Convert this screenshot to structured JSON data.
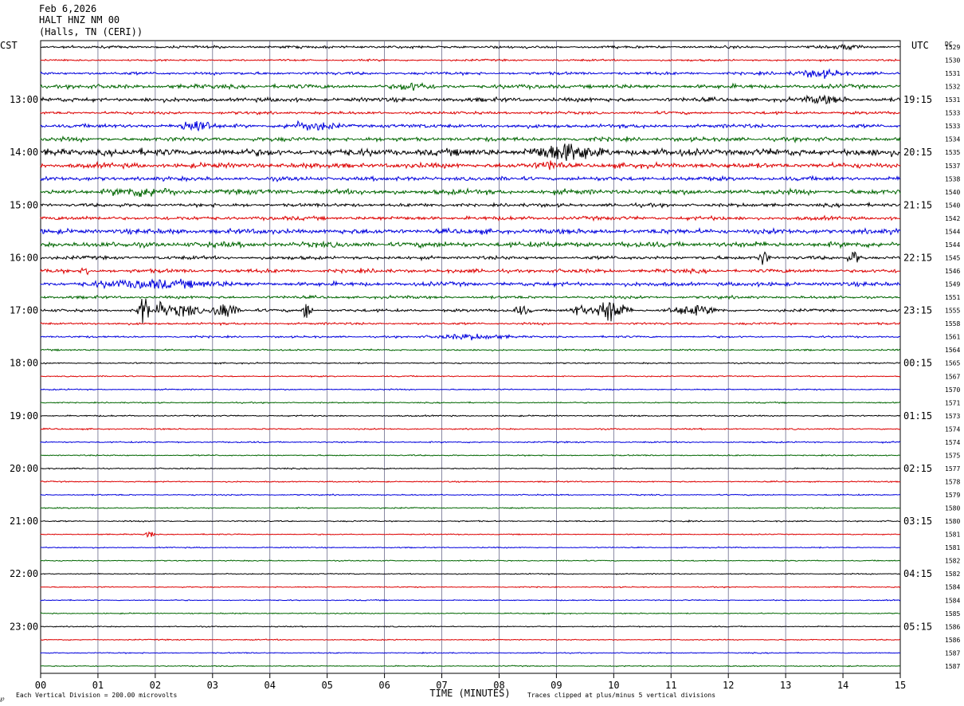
{
  "header": {
    "date": "Feb 6,2026",
    "station": "HALT HNZ NM 00",
    "location": "(Halls, TN (CERI))"
  },
  "footer": {
    "scale_note": "Each Vertical Division =  200.00 microvolts",
    "clip_note": "Traces clipped at plus/minus 5 vertical divisions",
    "corner_mark": "℘"
  },
  "chart_data": {
    "type": "line",
    "title": "",
    "xlabel": "TIME (MINUTES)",
    "left_axis_label": "CST",
    "right_axis_label": "UTC",
    "dc_label": "DC",
    "xlim": [
      0,
      15
    ],
    "x_ticks": [
      "00",
      "01",
      "02",
      "03",
      "04",
      "05",
      "06",
      "07",
      "08",
      "09",
      "10",
      "11",
      "12",
      "13",
      "14",
      "15"
    ],
    "grid": true,
    "trace_colors": [
      "#000000",
      "#dd0000",
      "#0000dd",
      "#006600"
    ],
    "left_hours": [
      {
        "row": 4,
        "label": "13:00"
      },
      {
        "row": 8,
        "label": "14:00"
      },
      {
        "row": 12,
        "label": "15:00"
      },
      {
        "row": 16,
        "label": "16:00"
      },
      {
        "row": 20,
        "label": "17:00"
      },
      {
        "row": 24,
        "label": "18:00"
      },
      {
        "row": 28,
        "label": "19:00"
      },
      {
        "row": 32,
        "label": "20:00"
      },
      {
        "row": 36,
        "label": "21:00"
      },
      {
        "row": 40,
        "label": "22:00"
      },
      {
        "row": 44,
        "label": "23:00"
      }
    ],
    "right_hours": [
      {
        "row": 4,
        "label": "19:15"
      },
      {
        "row": 8,
        "label": "20:15"
      },
      {
        "row": 12,
        "label": "21:15"
      },
      {
        "row": 16,
        "label": "22:15"
      },
      {
        "row": 20,
        "label": "23:15"
      },
      {
        "row": 24,
        "label": "00:15"
      },
      {
        "row": 28,
        "label": "01:15"
      },
      {
        "row": 32,
        "label": "02:15"
      },
      {
        "row": 36,
        "label": "03:15"
      },
      {
        "row": 40,
        "label": "04:15"
      },
      {
        "row": 44,
        "label": "05:15"
      }
    ],
    "dc_offsets": [
      "1529",
      "1530",
      "1531",
      "1532",
      "1531",
      "1533",
      "1533",
      "1534",
      "1535",
      "1537",
      "1538",
      "1540",
      "1540",
      "1542",
      "1544",
      "1544",
      "1545",
      "1546",
      "1549",
      "1551",
      "1555",
      "1558",
      "1561",
      "1564",
      "1565",
      "1567",
      "1570",
      "1571",
      "1573",
      "1574",
      "1574",
      "1575",
      "1577",
      "1578",
      "1579",
      "1580",
      "1580",
      "1581",
      "1581",
      "1582",
      "1582",
      "1584",
      "1584",
      "1585",
      "1586",
      "1586",
      "1587",
      "1587"
    ],
    "noise_level": [
      0.8,
      0.6,
      0.9,
      1.3,
      1.3,
      0.9,
      1.2,
      1.3,
      2.2,
      1.6,
      1.3,
      1.6,
      1.1,
      1.2,
      1.6,
      1.7,
      1.1,
      1.2,
      1.3,
      0.9,
      0.9,
      0.7,
      0.6,
      0.5,
      0.45,
      0.4,
      0.4,
      0.4,
      0.45,
      0.45,
      0.45,
      0.4,
      0.4,
      0.4,
      0.4,
      0.4,
      0.4,
      0.35,
      0.35,
      0.35,
      0.35,
      0.35,
      0.35,
      0.35,
      0.35,
      0.35,
      0.35,
      0.35
    ],
    "events": [
      {
        "row": 0,
        "minute": 14.1,
        "amplitude": 0.4,
        "duration": 0.3
      },
      {
        "row": 2,
        "minute": 13.6,
        "amplitude": 0.6,
        "duration": 0.6
      },
      {
        "row": 3,
        "minute": 6.5,
        "amplitude": 0.5,
        "duration": 0.4
      },
      {
        "row": 4,
        "minute": 13.7,
        "amplitude": 0.5,
        "duration": 0.5
      },
      {
        "row": 6,
        "minute": 2.7,
        "amplitude": 1.0,
        "duration": 0.4
      },
      {
        "row": 6,
        "minute": 4.7,
        "amplitude": 0.6,
        "duration": 0.6
      },
      {
        "row": 8,
        "minute": 9.2,
        "amplitude": 1.2,
        "duration": 0.9
      },
      {
        "row": 9,
        "minute": 8.9,
        "amplitude": 0.6,
        "duration": 0.3
      },
      {
        "row": 11,
        "minute": 1.8,
        "amplitude": 0.6,
        "duration": 0.8
      },
      {
        "row": 16,
        "minute": 12.6,
        "amplitude": 1.2,
        "duration": 0.15
      },
      {
        "row": 16,
        "minute": 14.2,
        "amplitude": 1.0,
        "duration": 0.15
      },
      {
        "row": 17,
        "minute": 0.8,
        "amplitude": 0.9,
        "duration": 0.1
      },
      {
        "row": 18,
        "minute": 2.0,
        "amplitude": 0.6,
        "duration": 1.5
      },
      {
        "row": 20,
        "minute": 1.8,
        "amplitude": 2.6,
        "duration": 0.15
      },
      {
        "row": 20,
        "minute": 2.1,
        "amplitude": 1.6,
        "duration": 0.15
      },
      {
        "row": 20,
        "minute": 2.5,
        "amplitude": 1.0,
        "duration": 0.4
      },
      {
        "row": 20,
        "minute": 3.2,
        "amplitude": 1.6,
        "duration": 0.3
      },
      {
        "row": 20,
        "minute": 4.65,
        "amplitude": 2.0,
        "duration": 0.1
      },
      {
        "row": 20,
        "minute": 8.4,
        "amplitude": 0.8,
        "duration": 0.2
      },
      {
        "row": 20,
        "minute": 9.4,
        "amplitude": 0.9,
        "duration": 0.2
      },
      {
        "row": 20,
        "minute": 9.95,
        "amplitude": 2.0,
        "duration": 0.4
      },
      {
        "row": 20,
        "minute": 11.4,
        "amplitude": 0.8,
        "duration": 0.6
      },
      {
        "row": 22,
        "minute": 7.5,
        "amplitude": 0.4,
        "duration": 0.9
      },
      {
        "row": 37,
        "minute": 1.9,
        "amplitude": 0.7,
        "duration": 0.1
      }
    ]
  }
}
